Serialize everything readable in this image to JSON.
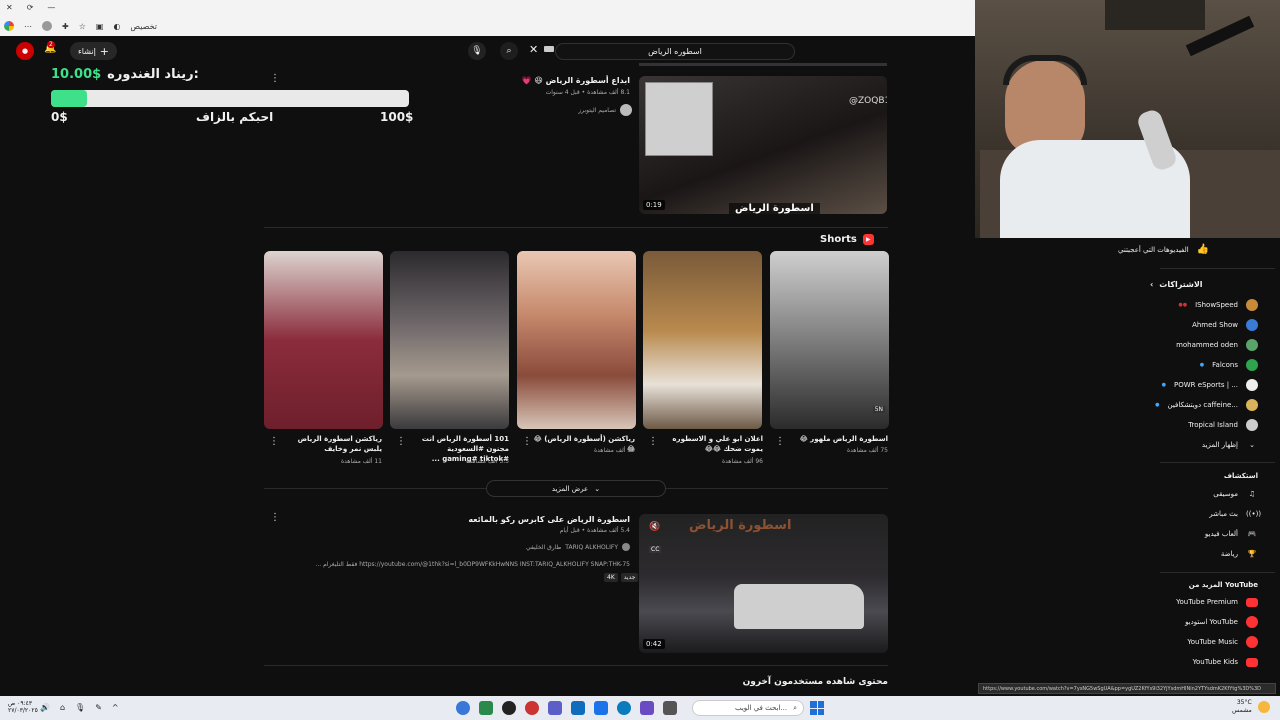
{
  "browser": {
    "tab_label": "تخصيص",
    "controls": [
      "✕",
      "⟳",
      "—"
    ]
  },
  "topbar": {
    "create_label": "إنشاء",
    "notifications_count": "2",
    "search_value": "اسطوره الرياض"
  },
  "donation": {
    "title": "ريناد الغندوره:",
    "amount": "10.00$",
    "progress_fraction": 0.1,
    "min": "0$",
    "max": "100$",
    "caption": "احبكم بالزاف"
  },
  "video1": {
    "title": "ابداع أسطورة الرياض 😆 💗",
    "meta": "8.1 ألف مشاهدة • قبل 4 سنوات",
    "channel": "تصاميم اليتوبرز",
    "duration": "0:19",
    "overlay_text": "اسطورة الرياض",
    "watermark": "@ZOQB1"
  },
  "shorts": {
    "section_title": "Shorts",
    "show_more": "عرض المزيد",
    "items": [
      {
        "title": "اسطورة الرياض ملهور 😂",
        "views": "75 ألف مشاهدة"
      },
      {
        "title": "اعلان ابو علي و الاسطوره يموت ضحك 😂😂",
        "views": "96 ألف مشاهدة"
      },
      {
        "title": "رياكشن (أسطورة الرياض) 😂 😂",
        "views": "39 ألف مشاهدة"
      },
      {
        "title": "101 أسطورة الرياض انت مجنون #السعودية #gaming# tiktok ...",
        "views": "3.3 ألف مشاهدة"
      },
      {
        "title": "رياكشن اسطورة الرياض يلبس نمر وخايف",
        "views": "11 ألف مشاهدة"
      }
    ],
    "tag_badge": "5N"
  },
  "video2": {
    "title": "اسطورة الرياض على كابرس ركو بالمائعه",
    "meta": "5.4 ألف مشاهدة • قبل أيام",
    "channel": "TARIQ ALKHOLIFY",
    "channel_ar": "طارق الخليفي",
    "description": "https://youtube.com/@1thk?si=l_b0DP9WFKkHwNNS INST:TARIQ_ALKHOLIFY SNAP:THK-75 فقط التليغرام ...",
    "badge_new": "جديد",
    "badge_4k": "4K",
    "duration": "0:42",
    "overlay_text": "اسطورة الرياض"
  },
  "next_section": "محتوى شاهده مستخدمون آخرون",
  "sidebar": {
    "liked": "الفيديوهات التي أعجبتني",
    "subs_title": "الاشتراكات",
    "subs": [
      {
        "name": "IShowSpeed",
        "color": "#c98a3a"
      },
      {
        "name": "Ahmed Show",
        "color": "#3a7bd5"
      },
      {
        "name": "mohammed oden",
        "color": "#5aa469"
      },
      {
        "name": "Falcons",
        "color": "#2ea44f"
      },
      {
        "name": "POWR eSports | ...",
        "color": "#eeeeee"
      },
      {
        "name": "دويتشكافين caffeine...",
        "color": "#d9b45a"
      },
      {
        "name": "Tropical Island",
        "color": "#cccccc"
      }
    ],
    "show_more": "إظهار المزيد",
    "explore_title": "استكشاف",
    "explore": [
      "موسيقى",
      "بث مباشر",
      "ألعاب فيديو",
      "رياضة"
    ],
    "more_title": "المزيد من YouTube",
    "more": [
      "YouTube Premium",
      "استوديو YouTube",
      "YouTube Music",
      "YouTube Kids"
    ]
  },
  "status_url": "https://www.youtube.com/watch?v=7ysNG5wSgUA&pp=ygUZ2KfYs9i32YjYsdmHINin2YTYsdmK2KfYtg%3D%3D",
  "taskbar": {
    "search_placeholder": "ابحث في الويب...",
    "time": "٠٩:٤٣ ص",
    "date": "٢٧/٠٣/٢٠٢٥",
    "weather": "35°C",
    "weather_desc": "مشمس"
  }
}
